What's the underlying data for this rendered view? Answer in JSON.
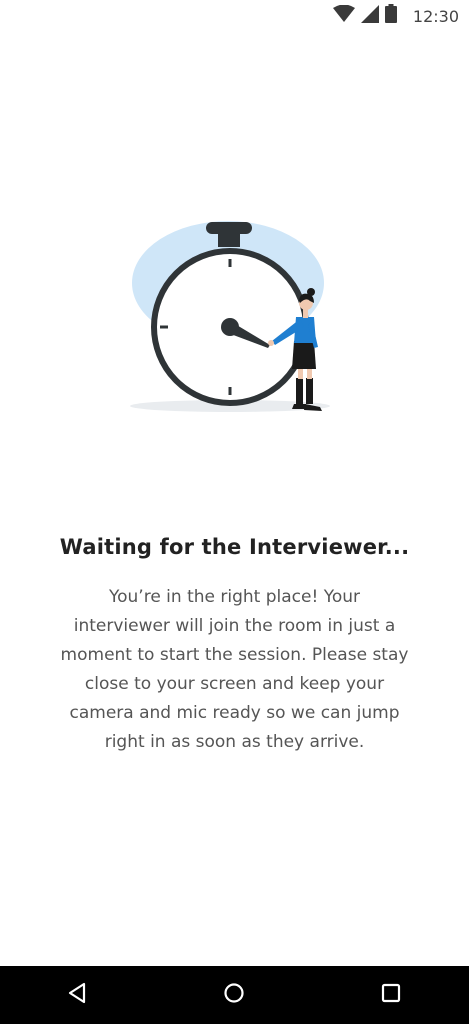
{
  "status_bar": {
    "time": "12:30",
    "icons": [
      "wifi-icon",
      "cellular-signal-icon",
      "battery-icon"
    ]
  },
  "illustration": {
    "icon": "stopwatch-with-woman-illustration",
    "colors": {
      "backdrop": "#cfe6f8",
      "stopwatch": "#2f3437",
      "shirt": "#1f7fd1",
      "shadow": "#e9ecef"
    }
  },
  "waiting": {
    "title": "Waiting for the Interviewer...",
    "message": "You’re in the right place! Your interviewer will join the room in just a moment to start the session. Please stay close to your screen and keep your camera and mic ready so we can jump right in as soon as they arrive."
  },
  "nav_bar": {
    "buttons": [
      "back-icon",
      "home-icon",
      "recents-icon"
    ]
  }
}
